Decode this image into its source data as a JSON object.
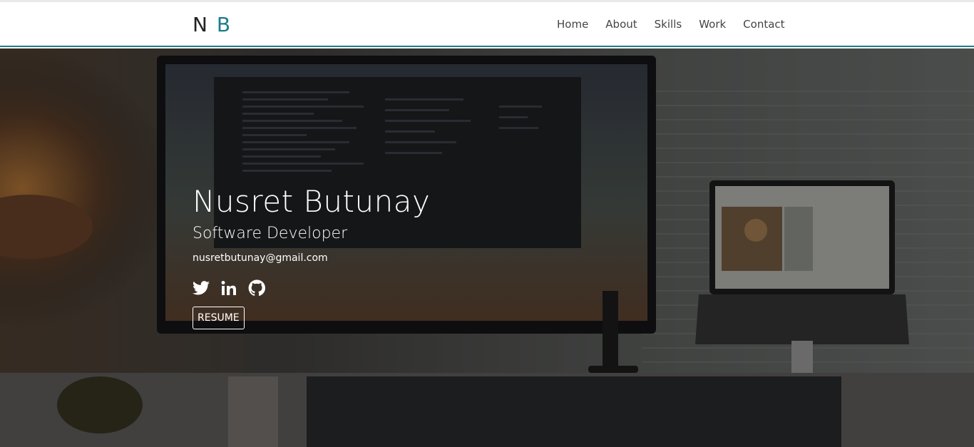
{
  "logo": {
    "first": "N",
    "second": "B"
  },
  "nav": {
    "items": [
      {
        "label": "Home"
      },
      {
        "label": "About"
      },
      {
        "label": "Skills"
      },
      {
        "label": "Work"
      },
      {
        "label": "Contact"
      }
    ]
  },
  "hero": {
    "name": "Nusret Butunay",
    "role": "Software Developer",
    "email": "nusretbutunay@gmail.com",
    "social": [
      "twitter-icon",
      "linkedin-icon",
      "github-icon"
    ],
    "resume_label": "RESUME"
  },
  "colors": {
    "accent": "#1d7d8c",
    "nav_text": "#444444",
    "hero_text": "#ffffff"
  }
}
